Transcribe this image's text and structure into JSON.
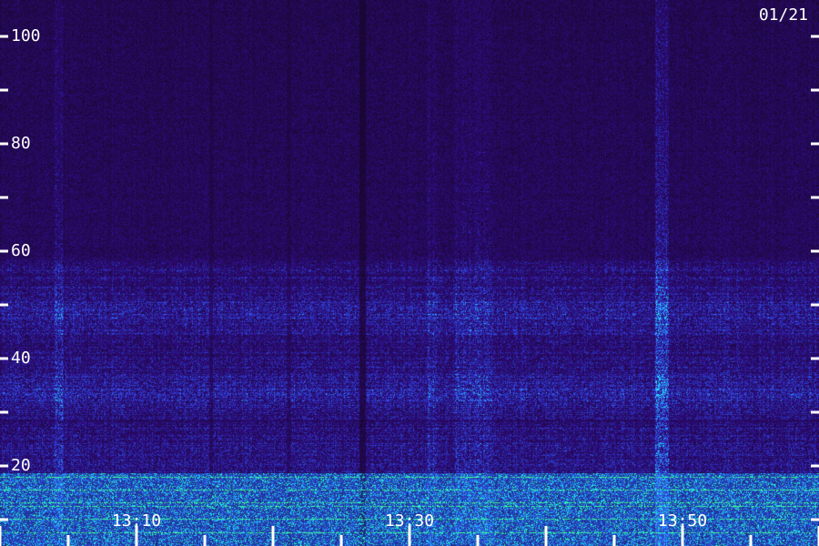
{
  "date_label": "01/21",
  "y_axis": {
    "tick_labels": [
      "100",
      "80",
      "60",
      "40",
      "20"
    ]
  },
  "x_axis": {
    "tick_labels": [
      "13:10",
      "13:30",
      "13:50"
    ]
  },
  "colors": {
    "background": "#14082e",
    "noise_low": "#2a0b6e",
    "noise_mid": "#2b38d8",
    "noise_high": "#22d7ff",
    "band_low_green": "#33ff88",
    "tick": "#ffffff",
    "text": "#ffffff"
  }
}
